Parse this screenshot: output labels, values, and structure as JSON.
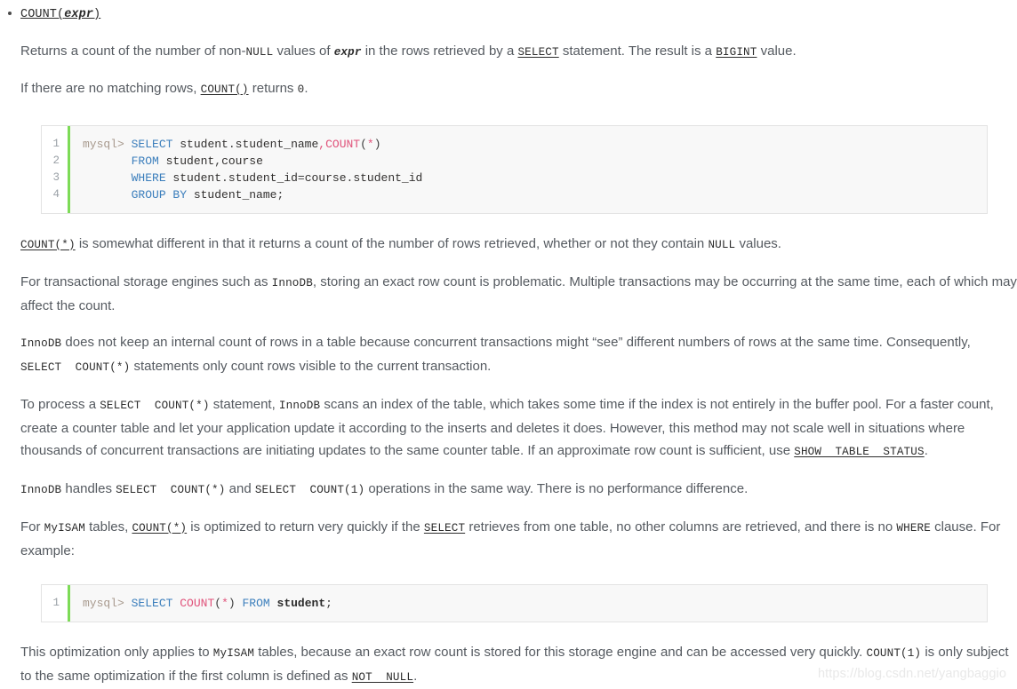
{
  "bullet": {
    "title_count": "COUNT(",
    "title_expr": "expr",
    "title_close": ")"
  },
  "paragraphs": {
    "p1_a": "Returns a count of the number of non-",
    "p1_null": "NULL",
    "p1_b": " values of ",
    "p1_expr": "expr",
    "p1_c": " in the rows retrieved by a ",
    "p1_select": "SELECT",
    "p1_d": " statement. The result is a ",
    "p1_bigint": "BIGINT",
    "p1_e": " value.",
    "p2_a": "If there are no matching rows, ",
    "p2_count": "COUNT()",
    "p2_b": " returns ",
    "p2_zero": "0",
    "p2_c": ".",
    "p3_count": "COUNT(*)",
    "p3_a": " is somewhat different in that it returns a count of the number of rows retrieved, whether or not they contain ",
    "p3_null": "NULL",
    "p3_b": " values.",
    "p4_a": "For transactional storage engines such as ",
    "p4_innodb": "InnoDB",
    "p4_b": ", storing an exact row count is problematic. Multiple transactions may be occurring at the same time, each of which may affect the count.",
    "p5_innodb": "InnoDB",
    "p5_a": " does not keep an internal count of rows in a table because concurrent transactions might “see” different numbers of rows at the same time. Consequently, ",
    "p5_select_count": "SELECT  COUNT(*)",
    "p5_b": " statements only count rows visible to the current transaction.",
    "p6_a": "To process a ",
    "p6_select_count": "SELECT  COUNT(*)",
    "p6_b": " statement, ",
    "p6_innodb": "InnoDB",
    "p6_c": " scans an index of the table, which takes some time if the index is not entirely in the buffer pool. For a faster count, create a counter table and let your application update it according to the inserts and deletes it does. However, this method may not scale well in situations where thousands of concurrent transactions are initiating updates to the same counter table. If an approximate row count is sufficient, use ",
    "p6_show": "SHOW  TABLE  STATUS",
    "p6_d": ".",
    "p7_innodb": "InnoDB",
    "p7_a": " handles ",
    "p7_sc1": "SELECT  COUNT(*)",
    "p7_b": " and ",
    "p7_sc2": "SELECT  COUNT(1)",
    "p7_c": " operations in the same way. There is no performance difference.",
    "p8_a": "For ",
    "p8_myisam": "MyISAM",
    "p8_b": " tables, ",
    "p8_count": "COUNT(*)",
    "p8_c": " is optimized to return very quickly if the ",
    "p8_select": "SELECT",
    "p8_d": " retrieves from one table, no other columns are retrieved, and there is no ",
    "p8_where": "WHERE",
    "p8_e": " clause. For example:",
    "p9_a": "This optimization only applies to ",
    "p9_myisam": "MyISAM",
    "p9_b": " tables, because an exact row count is stored for this storage engine and can be accessed very quickly. ",
    "p9_count1": "COUNT(1)",
    "p9_c": " is only subject to the same optimization if the first column is defined as ",
    "p9_notnull": "NOT  NULL",
    "p9_d": "."
  },
  "code_block_1": {
    "line_numbers": [
      "1",
      "2",
      "3",
      "4"
    ],
    "lines": [
      "mysql> SELECT student.student_name,COUNT(*)",
      "       FROM student,course",
      "       WHERE student.student_id=course.student_id",
      "       GROUP BY student_name;"
    ],
    "tokens": [
      [
        {
          "t": "mysql> ",
          "c": "prompt"
        },
        {
          "t": "SELECT",
          "c": "kw"
        },
        {
          "t": " ",
          "c": "id"
        },
        {
          "t": "student",
          "c": "id"
        },
        {
          "t": ".",
          "c": "punc"
        },
        {
          "t": "student_name",
          "c": "id"
        },
        {
          "t": ",",
          "c": "fn"
        },
        {
          "t": "COUNT",
          "c": "fn"
        },
        {
          "t": "(",
          "c": "punc"
        },
        {
          "t": "*",
          "c": "fn"
        },
        {
          "t": ")",
          "c": "punc"
        }
      ],
      [
        {
          "t": "       ",
          "c": "id"
        },
        {
          "t": "FROM",
          "c": "kw"
        },
        {
          "t": " student",
          "c": "id"
        },
        {
          "t": ",",
          "c": "punc"
        },
        {
          "t": "course",
          "c": "id"
        }
      ],
      [
        {
          "t": "       ",
          "c": "id"
        },
        {
          "t": "WHERE",
          "c": "kw"
        },
        {
          "t": " student",
          "c": "id"
        },
        {
          "t": ".",
          "c": "punc"
        },
        {
          "t": "student_id",
          "c": "id"
        },
        {
          "t": "=",
          "c": "punc"
        },
        {
          "t": "course",
          "c": "id"
        },
        {
          "t": ".",
          "c": "punc"
        },
        {
          "t": "student_id",
          "c": "id"
        }
      ],
      [
        {
          "t": "       ",
          "c": "id"
        },
        {
          "t": "GROUP BY",
          "c": "kw"
        },
        {
          "t": " student_name",
          "c": "id"
        },
        {
          "t": ";",
          "c": "punc"
        }
      ]
    ]
  },
  "code_block_2": {
    "line_numbers": [
      "1"
    ],
    "lines": [
      "mysql> SELECT COUNT(*) FROM student;"
    ],
    "tokens": [
      [
        {
          "t": "mysql> ",
          "c": "prompt"
        },
        {
          "t": "SELECT",
          "c": "kw"
        },
        {
          "t": " ",
          "c": "id"
        },
        {
          "t": "COUNT",
          "c": "fn"
        },
        {
          "t": "(",
          "c": "punc"
        },
        {
          "t": "*",
          "c": "fn"
        },
        {
          "t": ") ",
          "c": "punc"
        },
        {
          "t": "FROM",
          "c": "kw"
        },
        {
          "t": " ",
          "c": "id"
        },
        {
          "t": "student",
          "c": "idb"
        },
        {
          "t": ";",
          "c": "punc"
        }
      ]
    ]
  },
  "watermark": "https://blog.csdn.net/yangbaggio",
  "colors": {
    "text": "#555a60",
    "mono": "#2c2c2c",
    "keyword": "#3b7ebc",
    "function": "#e0527a",
    "prompt": "#a89a8e",
    "gutter_bar": "#7ddb57",
    "code_bg": "#f8f8f8",
    "code_border": "#e3e3e3",
    "watermark": "#e8e8e8"
  }
}
